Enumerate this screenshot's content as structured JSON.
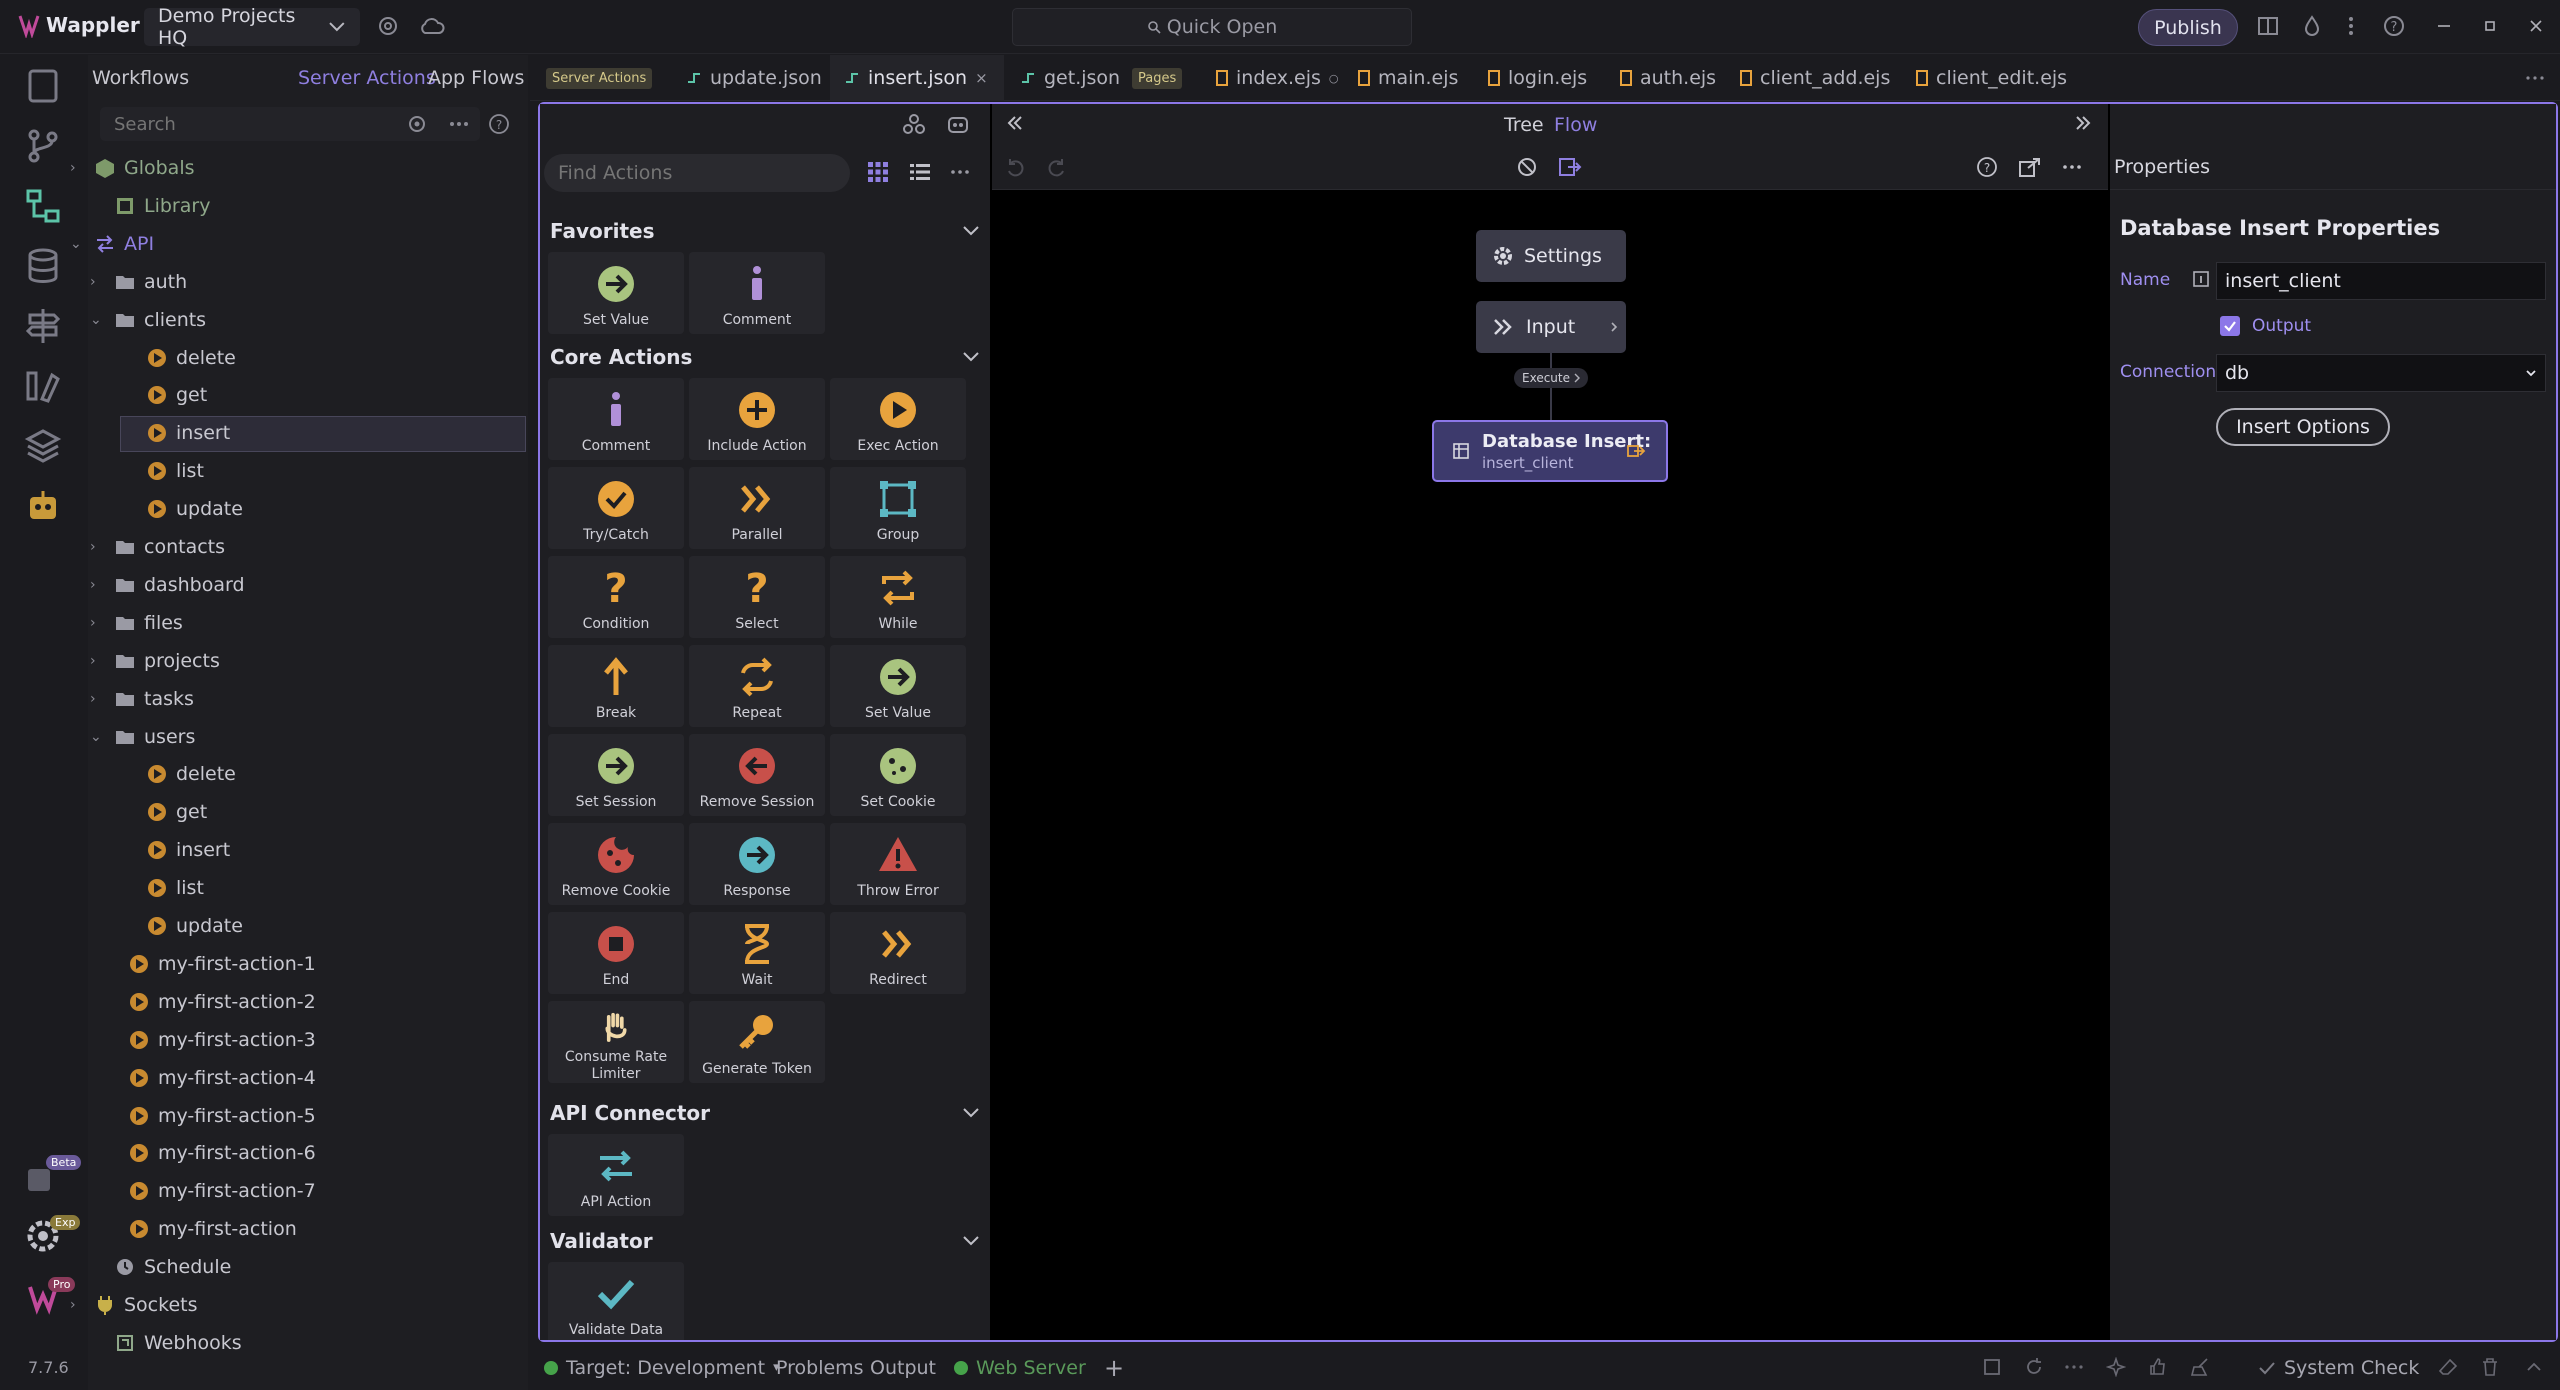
{
  "app": {
    "name": "Wappler",
    "version": "7.7.6"
  },
  "titlebar": {
    "project": "Demo Projects HQ",
    "quick_open": "Quick Open",
    "publish": "Publish"
  },
  "activity": {
    "beta": "Beta",
    "exp": "Exp",
    "pro": "Pro"
  },
  "sidebar": {
    "title": "Workflows",
    "tab_server": "Server Actions",
    "tab_app": "App Flows",
    "search_placeholder": "Search",
    "tree": [
      {
        "label": "Globals"
      },
      {
        "label": "Library"
      },
      {
        "label": "API"
      },
      {
        "label": "auth"
      },
      {
        "label": "clients"
      },
      {
        "label": "delete"
      },
      {
        "label": "get"
      },
      {
        "label": "insert"
      },
      {
        "label": "list"
      },
      {
        "label": "update"
      },
      {
        "label": "contacts"
      },
      {
        "label": "dashboard"
      },
      {
        "label": "files"
      },
      {
        "label": "projects"
      },
      {
        "label": "tasks"
      },
      {
        "label": "users"
      },
      {
        "label": "delete"
      },
      {
        "label": "get"
      },
      {
        "label": "insert"
      },
      {
        "label": "list"
      },
      {
        "label": "update"
      },
      {
        "label": "my-first-action-1"
      },
      {
        "label": "my-first-action-2"
      },
      {
        "label": "my-first-action-3"
      },
      {
        "label": "my-first-action-4"
      },
      {
        "label": "my-first-action-5"
      },
      {
        "label": "my-first-action-6"
      },
      {
        "label": "my-first-action-7"
      },
      {
        "label": "my-first-action"
      },
      {
        "label": "Schedule"
      },
      {
        "label": "Sockets"
      },
      {
        "label": "Webhooks"
      }
    ]
  },
  "tabs": {
    "pill_server": "Server Actions",
    "update": "update.json",
    "insert": "insert.json",
    "get": "get.json",
    "pill_pages": "Pages",
    "index": "index.ejs",
    "main": "main.ejs",
    "login": "login.ejs",
    "auth": "auth.ejs",
    "client_add": "client_add.ejs",
    "client_edit": "client_edit.ejs"
  },
  "actions": {
    "find_placeholder": "Find Actions",
    "favorites": "Favorites",
    "core": "Core Actions",
    "api_connector": "API Connector",
    "validator": "Validator",
    "fav_items": [
      {
        "label": "Set Value"
      },
      {
        "label": "Comment"
      }
    ],
    "core_items": [
      {
        "label": "Comment"
      },
      {
        "label": "Include Action"
      },
      {
        "label": "Exec Action"
      },
      {
        "label": "Try/Catch"
      },
      {
        "label": "Parallel"
      },
      {
        "label": "Group"
      },
      {
        "label": "Condition"
      },
      {
        "label": "Select"
      },
      {
        "label": "While"
      },
      {
        "label": "Break"
      },
      {
        "label": "Repeat"
      },
      {
        "label": "Set Value"
      },
      {
        "label": "Set Session"
      },
      {
        "label": "Remove Session"
      },
      {
        "label": "Set Cookie"
      },
      {
        "label": "Remove Cookie"
      },
      {
        "label": "Response"
      },
      {
        "label": "Throw Error"
      },
      {
        "label": "End"
      },
      {
        "label": "Wait"
      },
      {
        "label": "Redirect"
      },
      {
        "label": "Consume Rate Limiter"
      },
      {
        "label": "Generate Token"
      }
    ],
    "api_items": [
      {
        "label": "API Action"
      }
    ],
    "validator_items": [
      {
        "label": "Validate Data"
      }
    ]
  },
  "canvas": {
    "tree": "Tree",
    "flow": "Flow",
    "settings_node": "Settings",
    "input_node": "Input",
    "execute": "Execute",
    "db_title": "Database Insert:",
    "db_sub": "insert_client"
  },
  "props": {
    "header": "Properties",
    "title": "Database Insert Properties",
    "name_label": "Name",
    "name_value": "insert_client",
    "output_label": "Output",
    "connection_label": "Connection",
    "connection_value": "db",
    "insert_options": "Insert Options"
  },
  "status": {
    "target": "Target: Development",
    "problems": "Problems",
    "output": "Output",
    "web_server": "Web Server",
    "system_check": "System Check"
  },
  "colors": {
    "accent": "#8c77e8",
    "orange": "#e8a33d",
    "green_icon": "#a9c47f",
    "red_icon": "#c8504a",
    "teal": "#5cb8c4"
  }
}
